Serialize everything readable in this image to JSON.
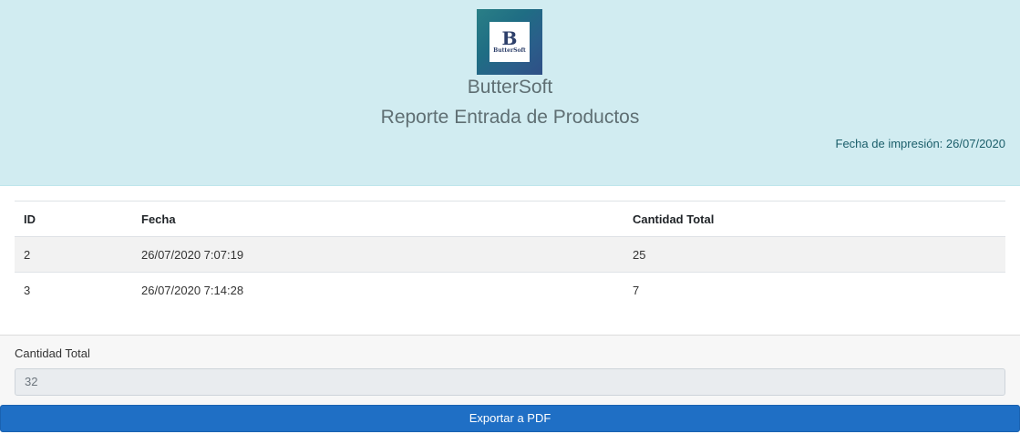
{
  "header": {
    "logo": {
      "letter": "B",
      "wordmark": "ButterSoft",
      "icon": "buttersoft-logo"
    },
    "brand": "ButterSoft",
    "title": "Reporte Entrada de Productos",
    "print_date_label": "Fecha de impresión:",
    "print_date_value": "26/07/2020"
  },
  "table": {
    "columns": [
      "ID",
      "Fecha",
      "Cantidad Total"
    ],
    "rows": [
      {
        "id": "2",
        "fecha": "26/07/2020 7:07:19",
        "cantidad": "25"
      },
      {
        "id": "3",
        "fecha": "26/07/2020 7:14:28",
        "cantidad": "7"
      }
    ]
  },
  "footer": {
    "total_label": "Cantidad Total",
    "total_value": "32",
    "export_label": "Exportar a PDF"
  },
  "colors": {
    "header_bg": "#d1ecf1",
    "button_bg": "#1f6fc5",
    "striped_row": "#f2f2f2"
  }
}
